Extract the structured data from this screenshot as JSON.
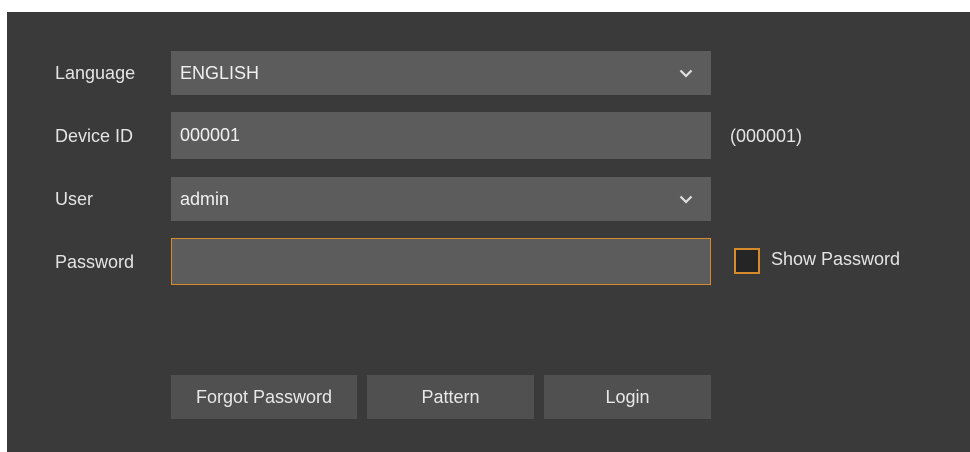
{
  "form": {
    "language": {
      "label": "Language",
      "value": "ENGLISH",
      "icon": "chevron-down-icon"
    },
    "device_id": {
      "label": "Device ID",
      "value": "000001",
      "hint": "(000001)"
    },
    "user": {
      "label": "User",
      "value": "admin",
      "icon": "chevron-down-icon"
    },
    "password": {
      "label": "Password",
      "value": "",
      "show_password_label": "Show Password",
      "show_password_checked": false
    }
  },
  "buttons": {
    "forgot_password": "Forgot Password",
    "pattern": "Pattern",
    "login": "Login"
  },
  "colors": {
    "panel_bg": "#3a3a3a",
    "field_bg": "#5c5c5c",
    "button_bg": "#505050",
    "focus_accent": "#d68a2a",
    "text": "#e4e4e4"
  }
}
